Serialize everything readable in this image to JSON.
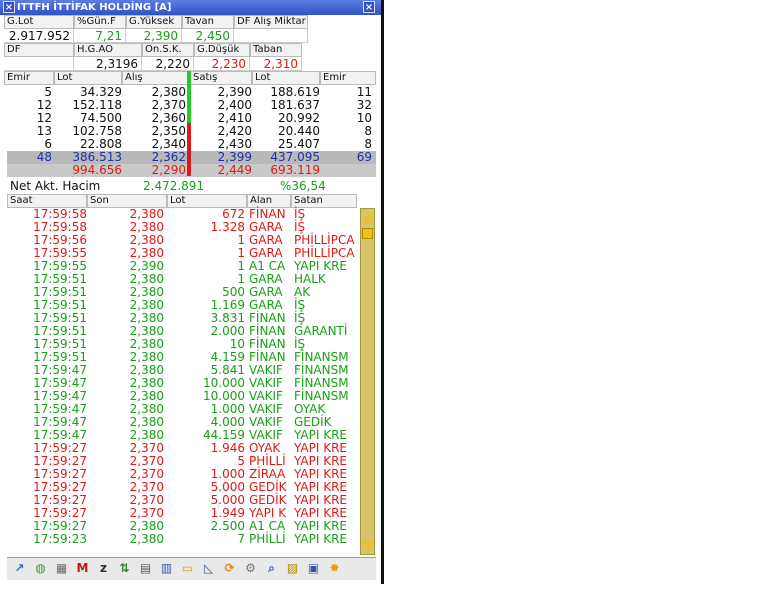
{
  "window": {
    "title": "ITTFH İTTİFAK HOLDİNG [A]",
    "close_label": "×",
    "menu_label": "×"
  },
  "summary1": {
    "headers": [
      "G.Lot",
      "%Gün.F",
      "G.Yüksek",
      "Tavan",
      "DF Alış Miktar"
    ],
    "values": [
      "2.917.952",
      "7,21",
      "2,390",
      "2,450",
      ""
    ]
  },
  "summary2": {
    "headers": [
      "DF",
      "H.G.AO",
      "On.S.K.",
      "G.Düşük",
      "Taban"
    ],
    "values": [
      "",
      "2,3196",
      "2,220",
      "2,230",
      "2,310"
    ]
  },
  "depth": {
    "headers": [
      "Emir",
      "Lot",
      "Alış",
      "Satış",
      "Lot",
      "Emir"
    ],
    "rows": [
      [
        "5",
        "34.329",
        "2,380",
        "2,390",
        "188.619",
        "11"
      ],
      [
        "12",
        "152.118",
        "2,370",
        "2,400",
        "181.637",
        "32"
      ],
      [
        "12",
        "74.500",
        "2,360",
        "2,410",
        "20.992",
        "10"
      ],
      [
        "13",
        "102.758",
        "2,350",
        "2,420",
        "20.440",
        "8"
      ],
      [
        "6",
        "22.808",
        "2,340",
        "2,430",
        "25.407",
        "8"
      ]
    ],
    "total": [
      "48",
      "386.513",
      "2,362",
      "2,399",
      "437.095",
      "69"
    ],
    "total2": [
      "",
      "994.656",
      "2,290",
      "2,449",
      "693.119",
      ""
    ]
  },
  "net": {
    "label": "Net Akt. Hacim",
    "value": "2.472.891",
    "percent": "%36,54"
  },
  "trades": {
    "headers": [
      "Saat",
      "Son",
      "Lot",
      "Alan",
      "Satan"
    ],
    "rows": [
      [
        "17:59:58",
        "2,380",
        "672",
        "FİNAN",
        "İŞ",
        "red"
      ],
      [
        "17:59:58",
        "2,380",
        "1.328",
        "GARA",
        "İŞ",
        "red"
      ],
      [
        "17:59:56",
        "2,380",
        "1",
        "GARA",
        "PHİLLİPCA",
        "red"
      ],
      [
        "17:59:55",
        "2,380",
        "1",
        "GARA",
        "PHİLLİPCA",
        "red"
      ],
      [
        "17:59:55",
        "2,390",
        "1",
        "A1 CA",
        "YAPI KRE",
        "green"
      ],
      [
        "17:59:51",
        "2,380",
        "1",
        "GARA",
        "HALK",
        "green"
      ],
      [
        "17:59:51",
        "2,380",
        "500",
        "GARA",
        "AK",
        "green"
      ],
      [
        "17:59:51",
        "2,380",
        "1.169",
        "GARA",
        "İŞ",
        "green"
      ],
      [
        "17:59:51",
        "2,380",
        "3.831",
        "FİNAN",
        "İŞ",
        "green"
      ],
      [
        "17:59:51",
        "2,380",
        "2.000",
        "FİNAN",
        "GARANTİ",
        "green"
      ],
      [
        "17:59:51",
        "2,380",
        "10",
        "FİNAN",
        "İŞ",
        "green"
      ],
      [
        "17:59:51",
        "2,380",
        "4.159",
        "FİNAN",
        "FİNANSM",
        "green"
      ],
      [
        "17:59:47",
        "2,380",
        "5.841",
        "VAKIF",
        "FİNANSM",
        "green"
      ],
      [
        "17:59:47",
        "2,380",
        "10.000",
        "VAKIF",
        "FİNANSM",
        "green"
      ],
      [
        "17:59:47",
        "2,380",
        "10.000",
        "VAKIF",
        "FİNANSM",
        "green"
      ],
      [
        "17:59:47",
        "2,380",
        "1.000",
        "VAKIF",
        "OYAK",
        "green"
      ],
      [
        "17:59:47",
        "2,380",
        "4.000",
        "VAKIF",
        "GEDİK",
        "green"
      ],
      [
        "17:59:47",
        "2,380",
        "44.159",
        "VAKIF",
        "YAPI KRE",
        "green"
      ],
      [
        "17:59:27",
        "2,370",
        "1.946",
        "OYAK",
        "YAPI KRE",
        "red"
      ],
      [
        "17:59:27",
        "2,370",
        "5",
        "PHİLLİ",
        "YAPI KRE",
        "red"
      ],
      [
        "17:59:27",
        "2,370",
        "1.000",
        "ZİRAA",
        "YAPI KRE",
        "red"
      ],
      [
        "17:59:27",
        "2,370",
        "5.000",
        "GEDİK",
        "YAPI KRE",
        "red"
      ],
      [
        "17:59:27",
        "2,370",
        "5.000",
        "GEDİK",
        "YAPI KRE",
        "red"
      ],
      [
        "17:59:27",
        "2,370",
        "1.949",
        "YAPI K",
        "YAPI KRE",
        "red"
      ],
      [
        "17:59:27",
        "2,380",
        "2.500",
        "A1 CA",
        "YAPI KRE",
        "green"
      ],
      [
        "17:59:23",
        "2,380",
        "7",
        "PHİLLİ",
        "YAPI KRE",
        "green"
      ]
    ]
  },
  "toolbar": {
    "icons": [
      "chart-icon",
      "globe-icon",
      "basket-icon",
      "m-icon",
      "zoom-icon",
      "updown-icon",
      "table-icon",
      "doc-icon",
      "folder-icon",
      "linechart-icon",
      "refresh-icon",
      "gear-icon",
      "search-icon",
      "bars-icon",
      "print-icon",
      "star-icon"
    ],
    "glyphs": [
      "↗",
      "◍",
      "▦",
      "M",
      "z",
      "⇅",
      "▤",
      "▥",
      "▭",
      "◺",
      "⟳",
      "⚙",
      "⌕",
      "▨",
      "▣",
      "✸"
    ]
  },
  "colors": {
    "green": "#18a018",
    "red": "#dd1a1a",
    "blue": "#1b2fa8",
    "title_bar": "#2f53c8",
    "scroll": "#d8c56b"
  }
}
